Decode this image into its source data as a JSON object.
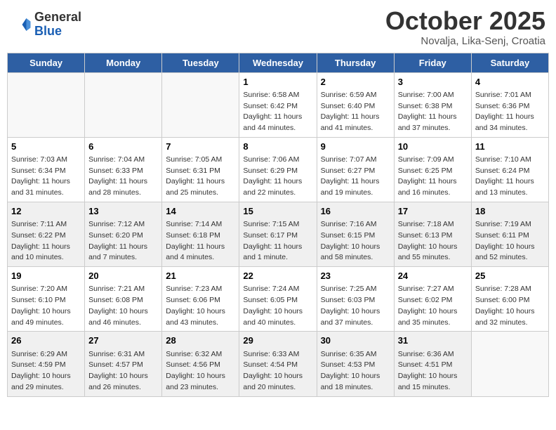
{
  "header": {
    "logo_general": "General",
    "logo_blue": "Blue",
    "month_title": "October 2025",
    "subtitle": "Novalja, Lika-Senj, Croatia"
  },
  "days_of_week": [
    "Sunday",
    "Monday",
    "Tuesday",
    "Wednesday",
    "Thursday",
    "Friday",
    "Saturday"
  ],
  "weeks": [
    {
      "shaded": false,
      "days": [
        {
          "num": "",
          "info": ""
        },
        {
          "num": "",
          "info": ""
        },
        {
          "num": "",
          "info": ""
        },
        {
          "num": "1",
          "info": "Sunrise: 6:58 AM\nSunset: 6:42 PM\nDaylight: 11 hours\nand 44 minutes."
        },
        {
          "num": "2",
          "info": "Sunrise: 6:59 AM\nSunset: 6:40 PM\nDaylight: 11 hours\nand 41 minutes."
        },
        {
          "num": "3",
          "info": "Sunrise: 7:00 AM\nSunset: 6:38 PM\nDaylight: 11 hours\nand 37 minutes."
        },
        {
          "num": "4",
          "info": "Sunrise: 7:01 AM\nSunset: 6:36 PM\nDaylight: 11 hours\nand 34 minutes."
        }
      ]
    },
    {
      "shaded": false,
      "days": [
        {
          "num": "5",
          "info": "Sunrise: 7:03 AM\nSunset: 6:34 PM\nDaylight: 11 hours\nand 31 minutes."
        },
        {
          "num": "6",
          "info": "Sunrise: 7:04 AM\nSunset: 6:33 PM\nDaylight: 11 hours\nand 28 minutes."
        },
        {
          "num": "7",
          "info": "Sunrise: 7:05 AM\nSunset: 6:31 PM\nDaylight: 11 hours\nand 25 minutes."
        },
        {
          "num": "8",
          "info": "Sunrise: 7:06 AM\nSunset: 6:29 PM\nDaylight: 11 hours\nand 22 minutes."
        },
        {
          "num": "9",
          "info": "Sunrise: 7:07 AM\nSunset: 6:27 PM\nDaylight: 11 hours\nand 19 minutes."
        },
        {
          "num": "10",
          "info": "Sunrise: 7:09 AM\nSunset: 6:25 PM\nDaylight: 11 hours\nand 16 minutes."
        },
        {
          "num": "11",
          "info": "Sunrise: 7:10 AM\nSunset: 6:24 PM\nDaylight: 11 hours\nand 13 minutes."
        }
      ]
    },
    {
      "shaded": true,
      "days": [
        {
          "num": "12",
          "info": "Sunrise: 7:11 AM\nSunset: 6:22 PM\nDaylight: 11 hours\nand 10 minutes."
        },
        {
          "num": "13",
          "info": "Sunrise: 7:12 AM\nSunset: 6:20 PM\nDaylight: 11 hours\nand 7 minutes."
        },
        {
          "num": "14",
          "info": "Sunrise: 7:14 AM\nSunset: 6:18 PM\nDaylight: 11 hours\nand 4 minutes."
        },
        {
          "num": "15",
          "info": "Sunrise: 7:15 AM\nSunset: 6:17 PM\nDaylight: 11 hours\nand 1 minute."
        },
        {
          "num": "16",
          "info": "Sunrise: 7:16 AM\nSunset: 6:15 PM\nDaylight: 10 hours\nand 58 minutes."
        },
        {
          "num": "17",
          "info": "Sunrise: 7:18 AM\nSunset: 6:13 PM\nDaylight: 10 hours\nand 55 minutes."
        },
        {
          "num": "18",
          "info": "Sunrise: 7:19 AM\nSunset: 6:11 PM\nDaylight: 10 hours\nand 52 minutes."
        }
      ]
    },
    {
      "shaded": false,
      "days": [
        {
          "num": "19",
          "info": "Sunrise: 7:20 AM\nSunset: 6:10 PM\nDaylight: 10 hours\nand 49 minutes."
        },
        {
          "num": "20",
          "info": "Sunrise: 7:21 AM\nSunset: 6:08 PM\nDaylight: 10 hours\nand 46 minutes."
        },
        {
          "num": "21",
          "info": "Sunrise: 7:23 AM\nSunset: 6:06 PM\nDaylight: 10 hours\nand 43 minutes."
        },
        {
          "num": "22",
          "info": "Sunrise: 7:24 AM\nSunset: 6:05 PM\nDaylight: 10 hours\nand 40 minutes."
        },
        {
          "num": "23",
          "info": "Sunrise: 7:25 AM\nSunset: 6:03 PM\nDaylight: 10 hours\nand 37 minutes."
        },
        {
          "num": "24",
          "info": "Sunrise: 7:27 AM\nSunset: 6:02 PM\nDaylight: 10 hours\nand 35 minutes."
        },
        {
          "num": "25",
          "info": "Sunrise: 7:28 AM\nSunset: 6:00 PM\nDaylight: 10 hours\nand 32 minutes."
        }
      ]
    },
    {
      "shaded": true,
      "days": [
        {
          "num": "26",
          "info": "Sunrise: 6:29 AM\nSunset: 4:59 PM\nDaylight: 10 hours\nand 29 minutes."
        },
        {
          "num": "27",
          "info": "Sunrise: 6:31 AM\nSunset: 4:57 PM\nDaylight: 10 hours\nand 26 minutes."
        },
        {
          "num": "28",
          "info": "Sunrise: 6:32 AM\nSunset: 4:56 PM\nDaylight: 10 hours\nand 23 minutes."
        },
        {
          "num": "29",
          "info": "Sunrise: 6:33 AM\nSunset: 4:54 PM\nDaylight: 10 hours\nand 20 minutes."
        },
        {
          "num": "30",
          "info": "Sunrise: 6:35 AM\nSunset: 4:53 PM\nDaylight: 10 hours\nand 18 minutes."
        },
        {
          "num": "31",
          "info": "Sunrise: 6:36 AM\nSunset: 4:51 PM\nDaylight: 10 hours\nand 15 minutes."
        },
        {
          "num": "",
          "info": ""
        }
      ]
    }
  ]
}
